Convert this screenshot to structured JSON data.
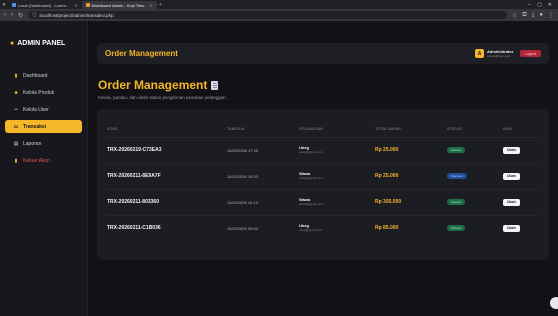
{
  "browser": {
    "tabs": [
      {
        "label": "Lokal (Dashboard) - Lorem...",
        "active": false
      },
      {
        "label": "Dashboard Admin - Kopi Toko",
        "active": true
      }
    ],
    "url": "localhost/project/admin/transaksi.php"
  },
  "sidebar": {
    "brand": "ADMIN PANEL",
    "items": [
      {
        "label": "Dashboard",
        "icon": "chart-icon"
      },
      {
        "label": "Kelola Produk",
        "icon": "box-icon"
      },
      {
        "label": "Kelola User",
        "icon": "users-icon"
      },
      {
        "label": "Transaksi",
        "icon": "card-icon"
      },
      {
        "label": "Laporan",
        "icon": "report-icon"
      },
      {
        "label": "Keluar Akun",
        "icon": "logout-icon"
      }
    ]
  },
  "topbar": {
    "title": "Order Management",
    "user": {
      "initial": "A",
      "name": "Administrator",
      "email": "admin@kopi.com"
    },
    "logout_label": "Logout"
  },
  "page": {
    "title": "Order Management",
    "subtitle": "Kelola, pantau, dan ubah status pengiriman pesanan pelanggan."
  },
  "table": {
    "headers": [
      "KODE",
      "TANGGAL",
      "PELANGGAN",
      "TOTAL BAYAR",
      "STATUS",
      "AKSI"
    ],
    "rows": [
      {
        "kode": "TRX-20260219-C73EA3",
        "tanggal": "19/02/2026 17:15",
        "pelanggan": "Ubeg",
        "email": "ubeg@gmail.com",
        "total": "Rp 25.000",
        "status": "Selesai",
        "status_color": "green",
        "aksi": "Ubah"
      },
      {
        "kode": "TRX-20260211-8E9A7F",
        "tanggal": "11/02/2026 10:20",
        "pelanggan": "Wawa",
        "email": "wawa@gmail.com",
        "total": "Rp 25.000",
        "status": "Diproses",
        "status_color": "blue",
        "aksi": "Ubah"
      },
      {
        "kode": "TRX-20260211-803360",
        "tanggal": "11/02/2026 10:13",
        "pelanggan": "Wawa",
        "email": "wawa@gmail.com",
        "total": "Rp 305.000",
        "status": "Selesai",
        "status_color": "green",
        "aksi": "Ubah"
      },
      {
        "kode": "TRX-20260211-C1B036",
        "tanggal": "11/02/2026 09:54",
        "pelanggan": "Ubeg",
        "email": "ubeg@gmail.com",
        "total": "Rp 85.000",
        "status": "Selesai",
        "status_color": "green",
        "aksi": "Ubah"
      }
    ]
  },
  "colors": {
    "accent": "#f5b62a",
    "danger": "#b3263a",
    "success": "#1f6e47",
    "info": "#1e4f9a"
  }
}
